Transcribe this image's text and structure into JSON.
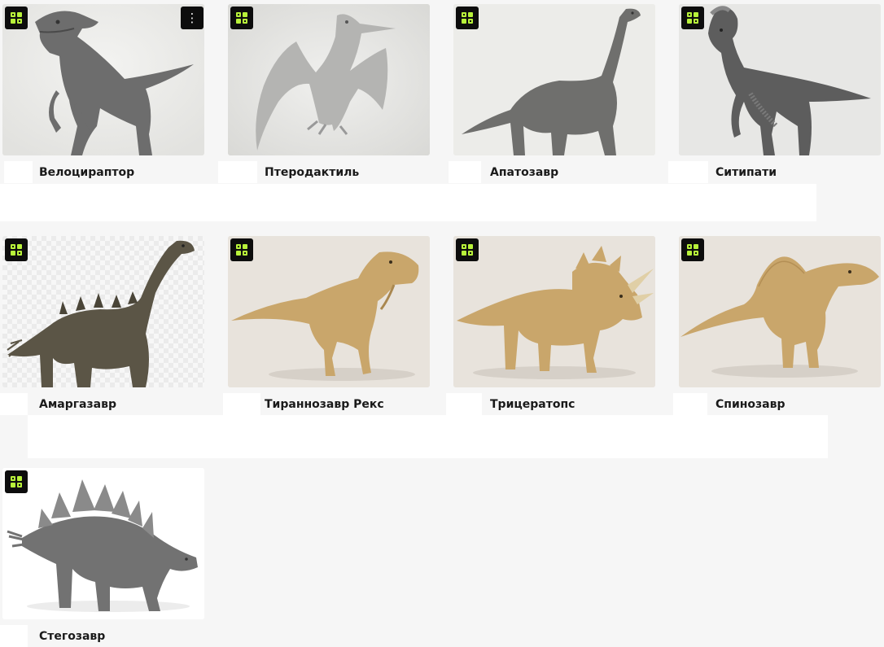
{
  "gallery": {
    "badge_icon": "model-3d-cube-icon",
    "badge_color": "#b8f23a",
    "menu_glyph": "⋮",
    "items": [
      {
        "label": "Велоцираптор",
        "theme": "gray"
      },
      {
        "label": "Птеродактиль",
        "theme": "gray"
      },
      {
        "label": "Апатозавр",
        "theme": "gray"
      },
      {
        "label": "Ситипати",
        "theme": "gray"
      },
      {
        "label": "Амаргазавр",
        "theme": "photo"
      },
      {
        "label": "Тираннозавр Рекс",
        "theme": "tan"
      },
      {
        "label": "Трицератопс",
        "theme": "tan"
      },
      {
        "label": "Спинозавр",
        "theme": "tan"
      },
      {
        "label": "Стегозавр",
        "theme": "gray"
      }
    ]
  }
}
